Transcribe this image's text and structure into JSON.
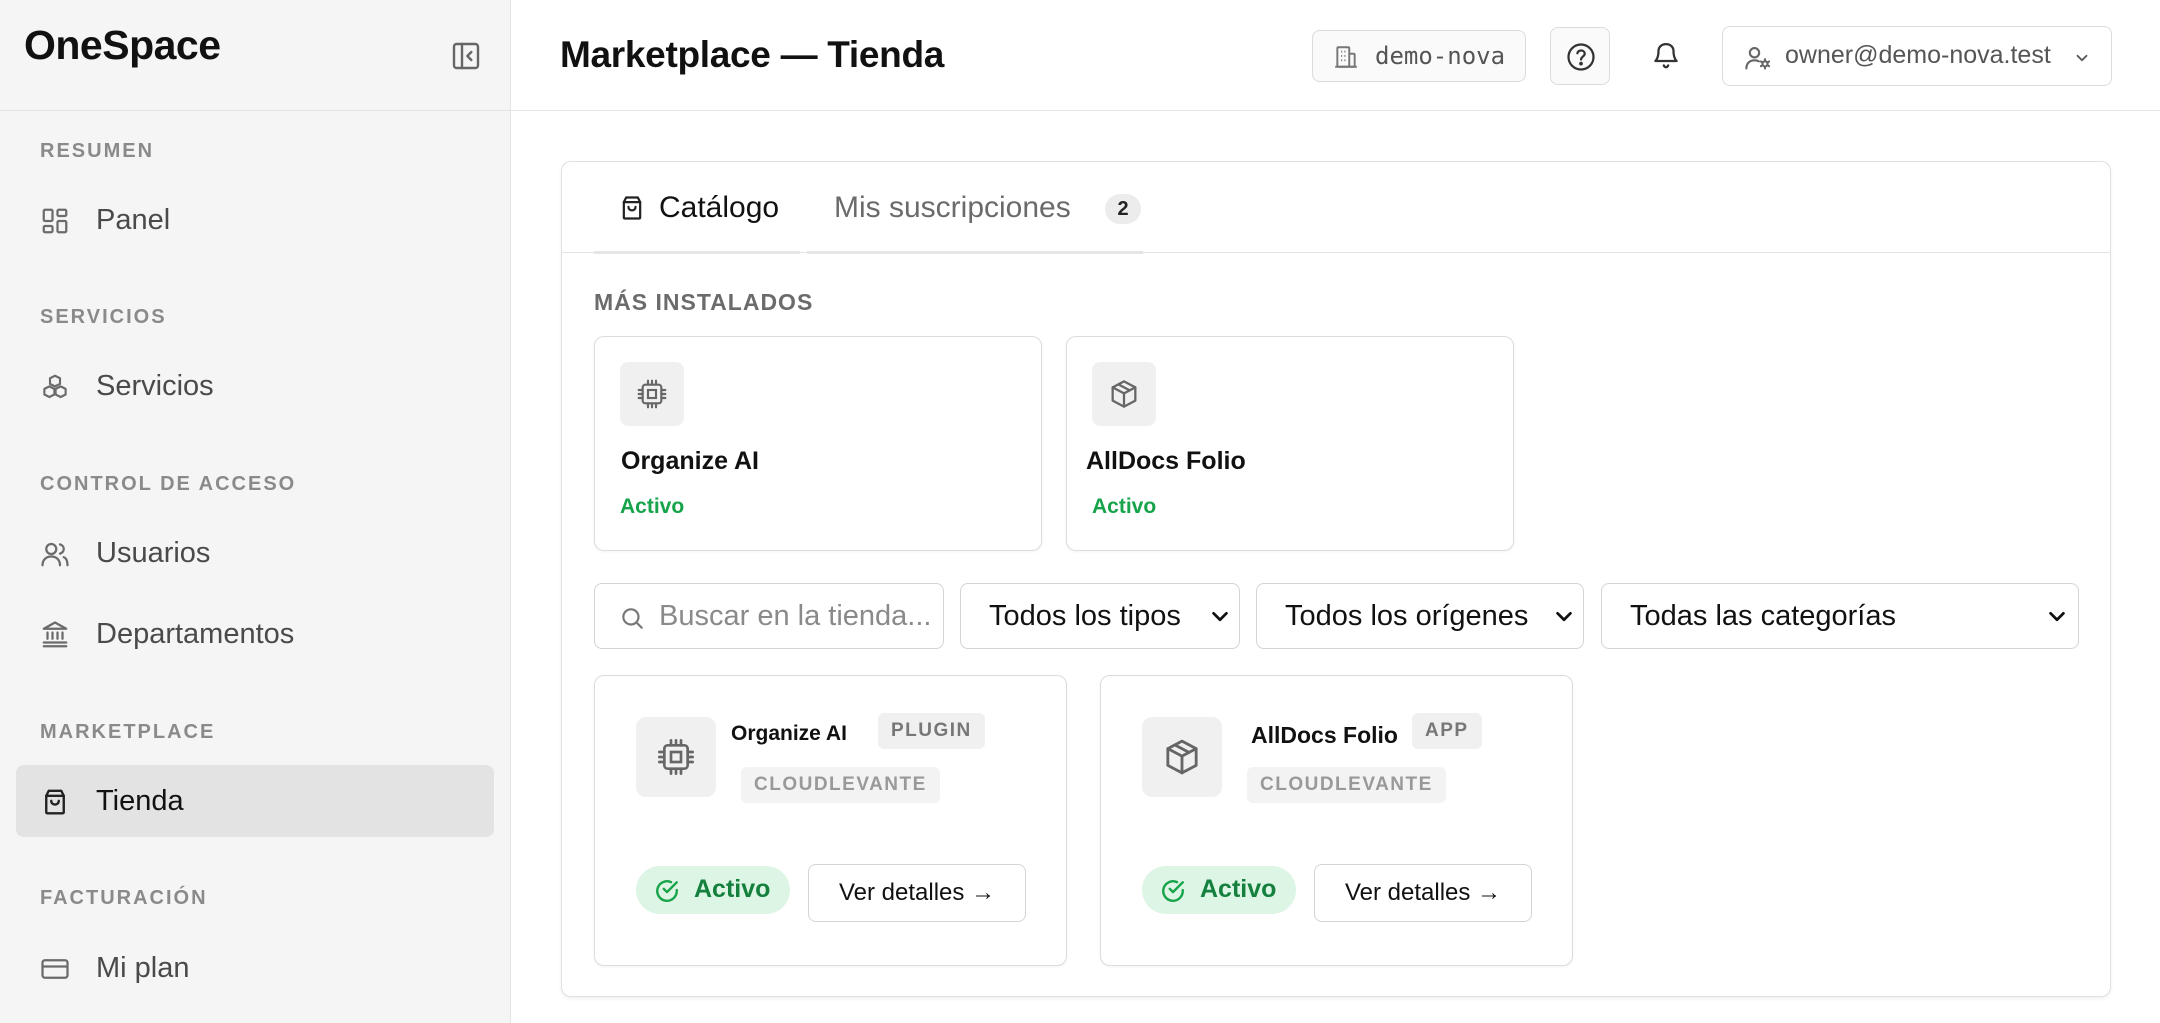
{
  "app": {
    "brand": "OneSpace"
  },
  "sidebar": {
    "sections": [
      {
        "label": "RESUMEN"
      },
      {
        "label": "SERVICIOS"
      },
      {
        "label": "CONTROL DE ACCESO"
      },
      {
        "label": "MARKETPLACE"
      },
      {
        "label": "FACTURACIÓN"
      }
    ],
    "items": [
      {
        "label": "Panel",
        "icon": "dashboard-icon"
      },
      {
        "label": "Servicios",
        "icon": "boxes-icon"
      },
      {
        "label": "Usuarios",
        "icon": "users-icon"
      },
      {
        "label": "Departamentos",
        "icon": "landmark-icon"
      },
      {
        "label": "Tienda",
        "icon": "shopping-bag-icon",
        "active": true
      },
      {
        "label": "Mi plan",
        "icon": "credit-card-icon"
      }
    ]
  },
  "header": {
    "title": "Marketplace — Tienda",
    "tenant": "demo-nova",
    "user_email": "owner@demo-nova.test"
  },
  "tabs": [
    {
      "label": "Catálogo",
      "active": true
    },
    {
      "label": "Mis suscripciones",
      "badge": "2"
    }
  ],
  "most_installed": {
    "heading": "MÁS INSTALADOS",
    "items": [
      {
        "name": "Organize AI",
        "status": "Activo",
        "icon": "cpu-icon"
      },
      {
        "name": "AllDocs Folio",
        "status": "Activo",
        "icon": "package-icon"
      }
    ]
  },
  "filters": {
    "search_placeholder": "Buscar en la tienda...",
    "type": "Todos los tipos",
    "origin": "Todos los orígenes",
    "category": "Todas las categorías"
  },
  "products": [
    {
      "name": "Organize AI",
      "type_tag": "PLUGIN",
      "vendor_tag": "CLOUDLEVANTE",
      "status": "Activo",
      "action": "Ver detalles →",
      "icon": "cpu-icon"
    },
    {
      "name": "AllDocs Folio",
      "type_tag": "APP",
      "vendor_tag": "CLOUDLEVANTE",
      "status": "Activo",
      "action": "Ver detalles →",
      "icon": "package-icon"
    }
  ],
  "colors": {
    "accent_green": "#16a34a",
    "active_nav_bg": "#e3e3e3"
  }
}
